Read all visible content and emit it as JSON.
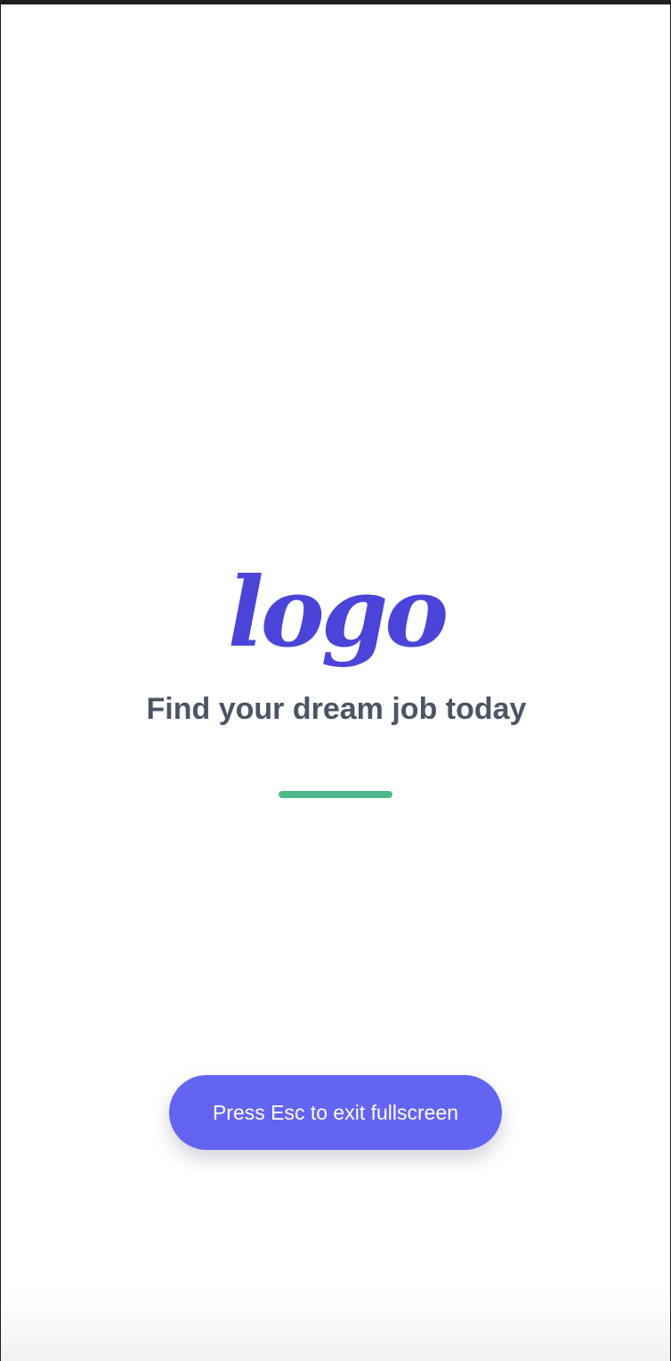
{
  "splash": {
    "logo_text": "logo",
    "tagline": "Find your dream job today",
    "loading_progress": 1.0
  },
  "toast": {
    "label": "Press Esc to exit fullscreen"
  },
  "colors": {
    "logo": "#4a45d8",
    "tagline": "#4b5563",
    "progress": "#4fb88a",
    "toast_background": "#6464f2"
  }
}
